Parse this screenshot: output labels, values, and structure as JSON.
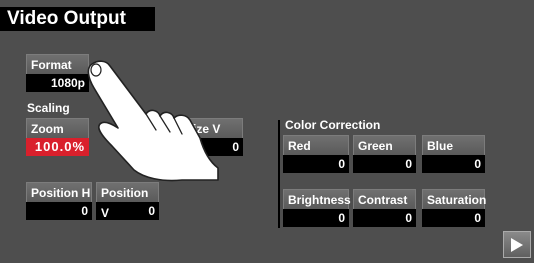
{
  "window": {
    "title": "Video Output"
  },
  "format": {
    "label": "Format",
    "value": "1080p"
  },
  "scaling": {
    "section_label": "Scaling",
    "zoom": {
      "label": "Zoom",
      "value": "100.0%"
    },
    "size_v": {
      "label": "Size V",
      "value": "0"
    },
    "position_h": {
      "label": "Position H",
      "value": "0"
    },
    "position_v": {
      "label": "Position V",
      "value": "0"
    }
  },
  "color_correction": {
    "section_label": "Color Correction",
    "red": {
      "label": "Red",
      "value": "0"
    },
    "green": {
      "label": "Green",
      "value": "0"
    },
    "blue": {
      "label": "Blue",
      "value": "0"
    },
    "brightness": {
      "label": "Brightness",
      "value": "0"
    },
    "contrast": {
      "label": "Contrast",
      "value": "0"
    },
    "saturation": {
      "label": "Saturation",
      "value": "0"
    }
  },
  "colors": {
    "active_value": "#d9202c",
    "panel": "#4e4e4e",
    "value_bg": "#000000"
  },
  "icons": {
    "next": "play-triangle-icon",
    "pointer": "hand-pointer-icon"
  }
}
